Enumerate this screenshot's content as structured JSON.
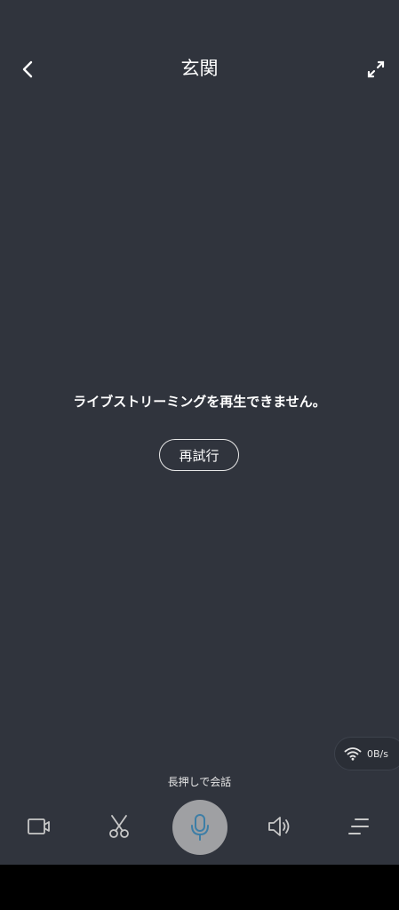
{
  "header": {
    "title": "玄関"
  },
  "icons": {
    "back": "chevron-left-icon",
    "fullscreen": "expand-icon",
    "wifi": "wifi-icon",
    "record": "video-camera-icon",
    "screenshot": "scissors-icon",
    "mic": "microphone-icon",
    "speaker": "speaker-icon",
    "menu": "menu-lines-icon"
  },
  "player": {
    "error_message": "ライブストリーミングを再生できません。",
    "retry_label": "再試行"
  },
  "network": {
    "speed": "0B/s"
  },
  "talk": {
    "hint": "長押しで会話"
  },
  "colors": {
    "background": "#30343d",
    "mic_button": "#9fa0a3",
    "mic_icon": "#3d7ea6"
  }
}
